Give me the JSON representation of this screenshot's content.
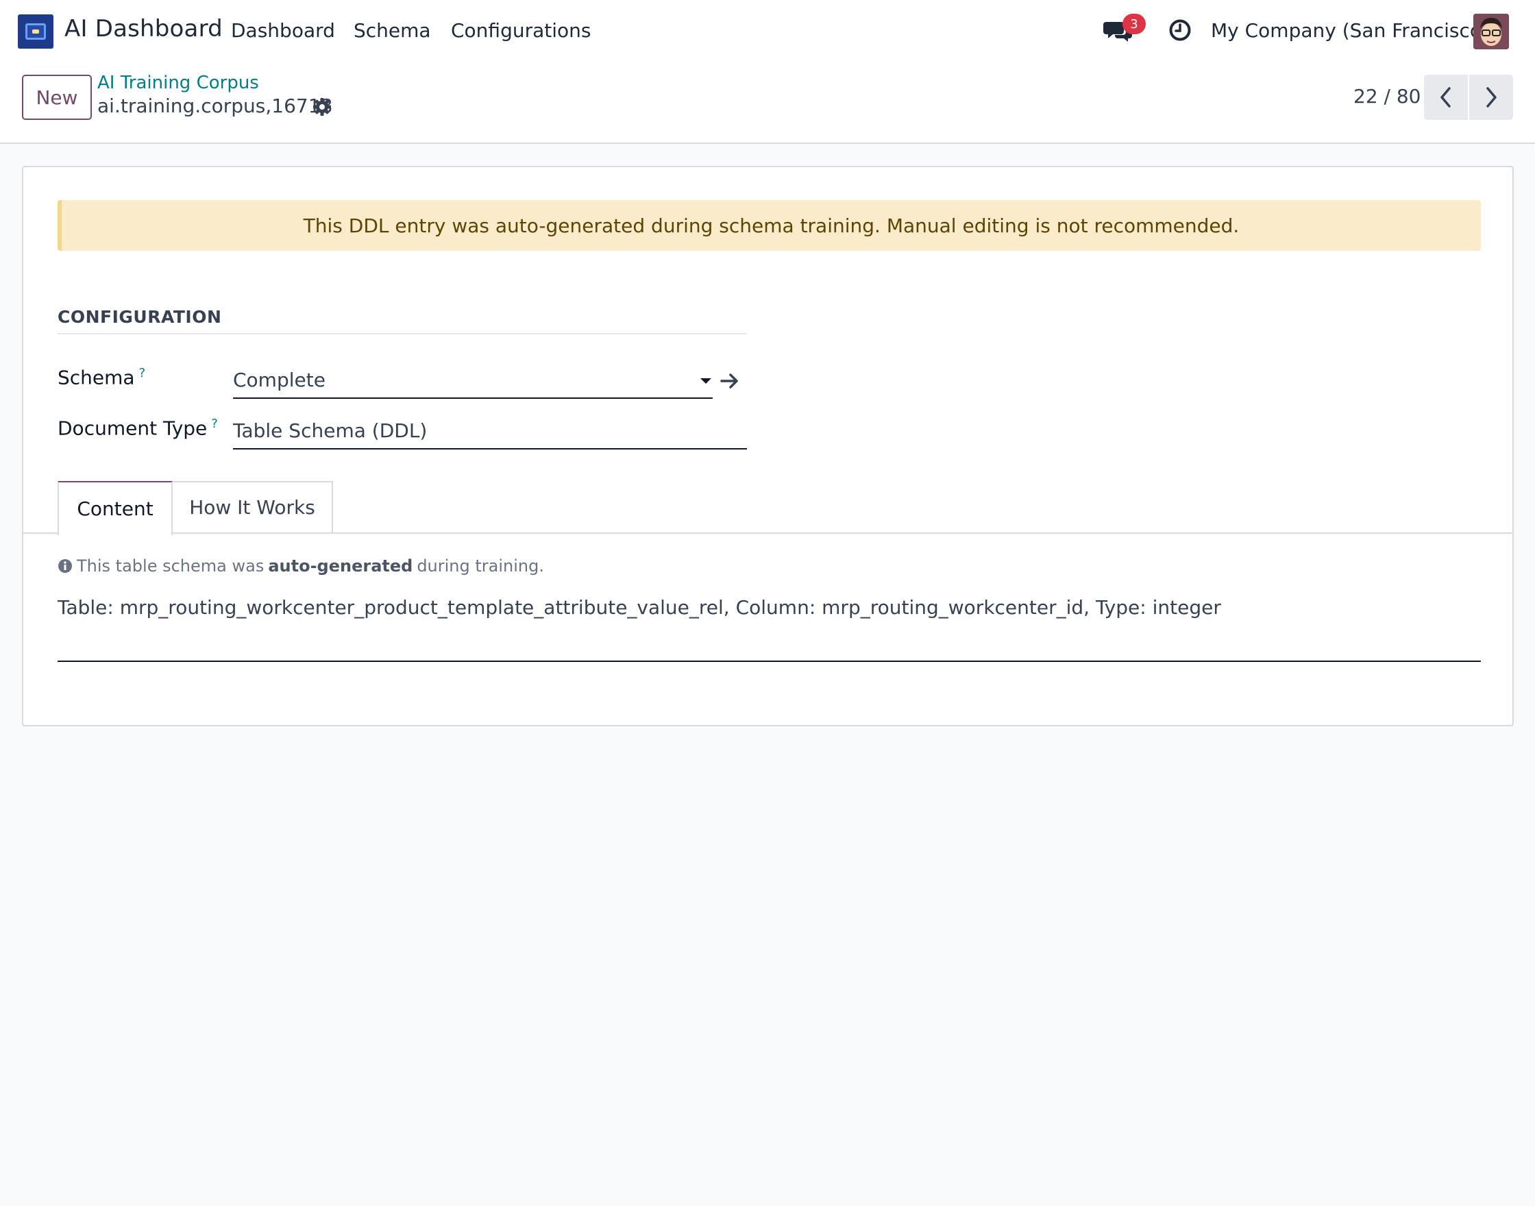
{
  "navbar": {
    "app_title": "AI Dashboard",
    "menu": [
      "Dashboard",
      "Schema",
      "Configurations"
    ],
    "messages_badge": "3",
    "company": "My Company (San Francisco)"
  },
  "control_panel": {
    "new_button": "New",
    "breadcrumb": "AI Training Corpus",
    "record_name": "ai.training.corpus,16718",
    "pager": "22 / 80"
  },
  "form": {
    "alert": "This DDL entry was auto-generated during schema training. Manual editing is not recommended.",
    "section_title": "CONFIGURATION",
    "fields": {
      "schema_label": "Schema",
      "schema_value": "Complete",
      "doctype_label": "Document Type",
      "doctype_value": "Table Schema (DDL)",
      "help_marker": "?"
    },
    "tabs": [
      "Content",
      "How It Works"
    ],
    "info": {
      "prefix": "This table schema was",
      "bold": "auto-generated",
      "suffix": "during training."
    },
    "content": "Table: mrp_routing_workcenter_product_template_attribute_value_rel, Column: mrp_routing_workcenter_id, Type: integer"
  },
  "colors": {
    "brand": "#714b67",
    "link": "#017e84",
    "badge": "#dc3545",
    "alert_bg": "#faeccb"
  },
  "icons": [
    "app-icon",
    "chat-icon",
    "clock-icon",
    "avatar",
    "gear-icon",
    "chevron-left-icon",
    "chevron-right-icon",
    "caret-down-icon",
    "arrow-right-icon",
    "info-icon"
  ]
}
